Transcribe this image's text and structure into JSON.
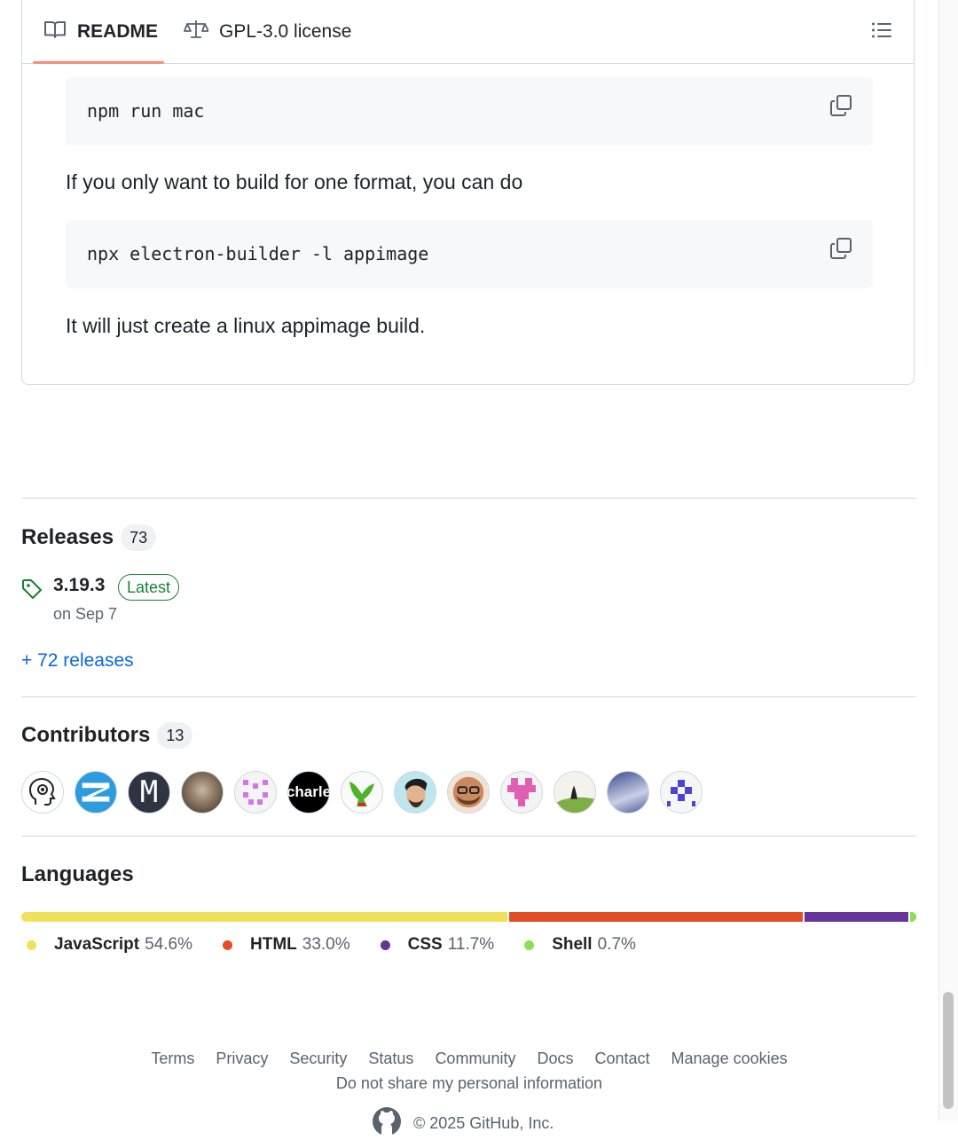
{
  "readme": {
    "tabs": [
      {
        "label": "README",
        "icon": "book-icon",
        "active": true
      },
      {
        "label": "GPL-3.0 license",
        "icon": "scale-icon",
        "active": false
      }
    ],
    "code_blocks": [
      "npm run mac",
      "npx electron-builder -l appimage"
    ],
    "paragraphs": [
      "If you only want to build for one format, you can do",
      "It will just create a linux appimage build."
    ]
  },
  "releases": {
    "title": "Releases",
    "count": "73",
    "latest": {
      "version": "3.19.3",
      "badge": "Latest",
      "date": "on Sep 7"
    },
    "more_link": "+ 72 releases"
  },
  "contributors": {
    "title": "Contributors",
    "count": "13",
    "avatars": [
      "M",
      "charle"
    ]
  },
  "languages": {
    "title": "Languages",
    "items": [
      {
        "name": "JavaScript",
        "percent": "54.6%",
        "value": 54.6,
        "color": "#f1e05a"
      },
      {
        "name": "HTML",
        "percent": "33.0%",
        "value": 33.0,
        "color": "#e34c26"
      },
      {
        "name": "CSS",
        "percent": "11.7%",
        "value": 11.7,
        "color": "#663399"
      },
      {
        "name": "Shell",
        "percent": "0.7%",
        "value": 0.7,
        "color": "#89e051"
      }
    ]
  },
  "footer": {
    "links": [
      "Terms",
      "Privacy",
      "Security",
      "Status",
      "Community",
      "Docs",
      "Contact",
      "Manage cookies"
    ],
    "privacy": "Do not share my personal information",
    "copyright": "© 2025 GitHub, Inc."
  }
}
